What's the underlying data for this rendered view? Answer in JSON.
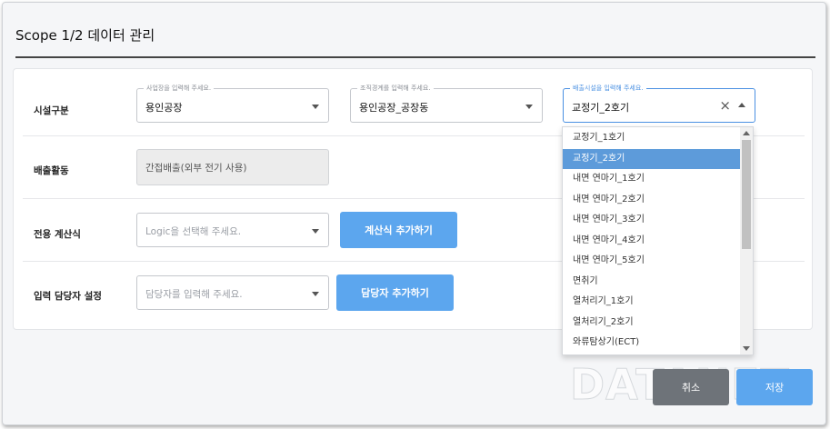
{
  "dialog": {
    "title": "Scope 1/2 데이터 관리"
  },
  "rows": {
    "facility": {
      "label": "시설구분",
      "site": {
        "float_label": "사업장을 입력해 주세요.",
        "value": "용인공장"
      },
      "org": {
        "float_label": "조직경계를 입력해 주세요.",
        "value": "용인공장_공장동"
      },
      "emission_facility": {
        "float_label": "배출시설을 입력해 주세요.",
        "value": "교정기_2호기"
      }
    },
    "activity": {
      "label": "배출활동",
      "value": "간접배출(외부 전기 사용)"
    },
    "formula": {
      "label": "전용 계산식",
      "placeholder": "Logic을 선택해 주세요.",
      "add_button": "계산식 추가하기"
    },
    "assignee": {
      "label": "입력 담당자 설정",
      "placeholder": "담당자를 입력해 주세요.",
      "add_button": "담당자 추가하기"
    }
  },
  "dropdown": {
    "selected_index": 1,
    "options": [
      "교정기_1호기",
      "교정기_2호기",
      "내면 연마기_1호기",
      "내면 연마기_2호기",
      "내면 연마기_3호기",
      "내면 연마기_4호기",
      "내면 연마기_5호기",
      "면취기",
      "열처리기_1호기",
      "열처리기_2호기",
      "와류탐상기(ECT)"
    ]
  },
  "footer": {
    "cancel_label": "취소",
    "save_label": "저장"
  },
  "watermark": "DATANET",
  "colors": {
    "accent": "#5ca6ee",
    "selected_option": "#5d9bda",
    "cancel": "#6e7379"
  }
}
